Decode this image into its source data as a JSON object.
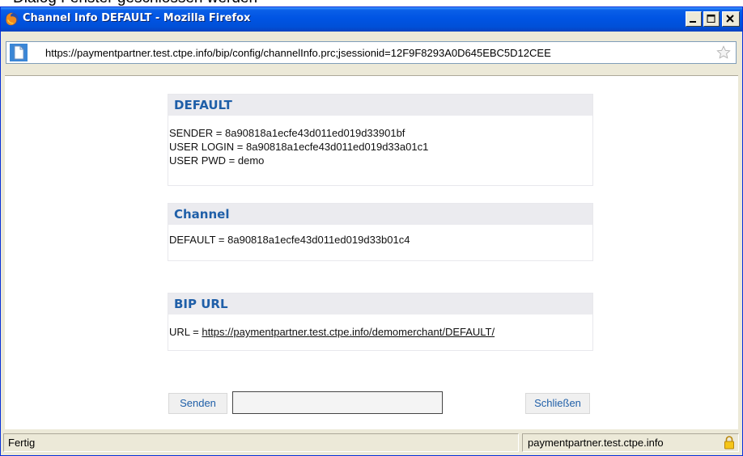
{
  "background_fragment": "Dialog Fenster geschlossen werden",
  "window": {
    "title": "Channel Info DEFAULT - Mozilla Firefox",
    "title_icon": "firefox-icon",
    "controls": [
      "minimize-icon",
      "maximize-icon",
      "close-icon"
    ]
  },
  "urlbar": {
    "url": "https://paymentpartner.test.ctpe.info/bip/config/channelInfo.prc;jsessionid=12F9F8293A0D645EBC5D12CEE",
    "page_icon": "page-icon",
    "bookmark_icon": "star-icon"
  },
  "sections": [
    {
      "header": "DEFAULT",
      "lines": [
        "SENDER = 8a90818a1ecfe43d011ed019d33901bf",
        "USER LOGIN = 8a90818a1ecfe43d011ed019d33a01c1",
        "USER PWD = demo"
      ]
    },
    {
      "header": "Channel",
      "lines": [
        "DEFAULT = 8a90818a1ecfe43d011ed019d33b01c4"
      ]
    },
    {
      "header": "BIP URL",
      "url_prefix": "URL = ",
      "url_link": "https://paymentpartner.test.ctpe.info/demomerchant/DEFAULT/"
    }
  ],
  "controls": {
    "send_label": "Senden",
    "input_value": "",
    "close_label": "Schließen"
  },
  "statusbar": {
    "status": "Fertig",
    "domain": "paymentpartner.test.ctpe.info",
    "security_icon": "lock-icon"
  },
  "colors": {
    "titlebar": "#0054e3",
    "section_header_text": "#1f5fa8",
    "section_header_bg": "#ebebef",
    "chrome": "#ece9d8"
  }
}
